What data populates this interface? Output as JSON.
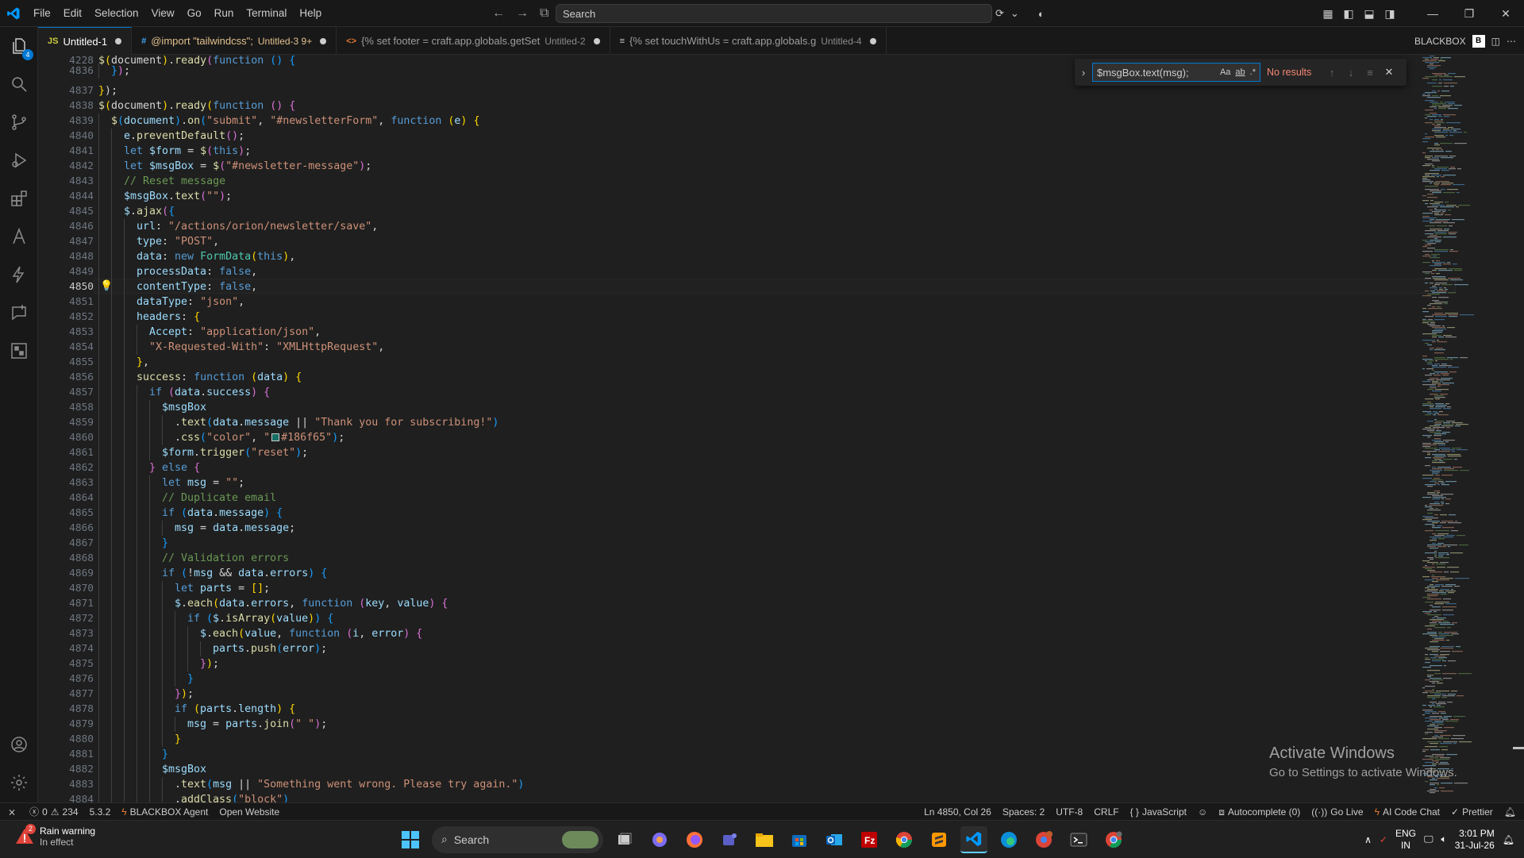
{
  "menu": [
    "File",
    "Edit",
    "Selection",
    "View",
    "Go",
    "Run",
    "Terminal",
    "Help"
  ],
  "command_center": {
    "placeholder": "Search"
  },
  "tabs": [
    {
      "icon": "JS",
      "label": "Untitled-1",
      "desc": "",
      "active": true
    },
    {
      "icon": "#",
      "label": "@import \"tailwindcss\";",
      "desc": "Untitled-3 9+",
      "active": false
    },
    {
      "icon": "<>",
      "label": "{% set footer = craft.app.globals.getSet",
      "desc": "Untitled-2",
      "active": false
    },
    {
      "icon": "≡",
      "label": "{% set touchWithUs = craft.app.globals.g",
      "desc": "Untitled-4",
      "active": false
    }
  ],
  "tabs_right_label": "BLACKBOX",
  "activity_badge": "4",
  "find": {
    "value": "$msgBox.text(msg);",
    "case": "Aa",
    "word": "ab",
    "regex": ".*",
    "result": "No results"
  },
  "line_numbers": [
    "4228",
    "4836",
    "4837",
    "4838",
    "4839",
    "4840",
    "4841",
    "4842",
    "4843",
    "4844",
    "4845",
    "4846",
    "4847",
    "4848",
    "4849",
    "4850",
    "4851",
    "4852",
    "4853",
    "4854",
    "4855",
    "4856",
    "4857",
    "4858",
    "4859",
    "4860",
    "4861",
    "4862",
    "4863",
    "4864",
    "4865",
    "4866",
    "4867",
    "4868",
    "4869",
    "4870",
    "4871",
    "4872",
    "4873",
    "4874",
    "4875",
    "4876",
    "4877",
    "4878",
    "4879",
    "4880",
    "4881",
    "4882",
    "4883",
    "4884"
  ],
  "current_line": "4850",
  "watermark": {
    "title": "Activate Windows",
    "sub": "Go to Settings to activate Windows."
  },
  "status": {
    "errors": "0",
    "warnings": "234",
    "version": "5.3.2",
    "agent": "BLACKBOX Agent",
    "open_site": "Open Website",
    "position": "Ln 4850, Col 26",
    "spaces": "Spaces: 2",
    "encoding": "UTF-8",
    "eol": "CRLF",
    "language": "JavaScript",
    "autocomplete": "Autocomplete (0)",
    "golive": "Go Live",
    "aichat": "AI Code Chat",
    "prettier": "Prettier"
  },
  "taskbar": {
    "weather_badge": "2",
    "weather_title": "Rain warning",
    "weather_sub": "In effect",
    "search": "Search",
    "lang1": "ENG",
    "lang2": "IN",
    "time": "3:01 PM",
    "date": "31-Jul-26"
  }
}
